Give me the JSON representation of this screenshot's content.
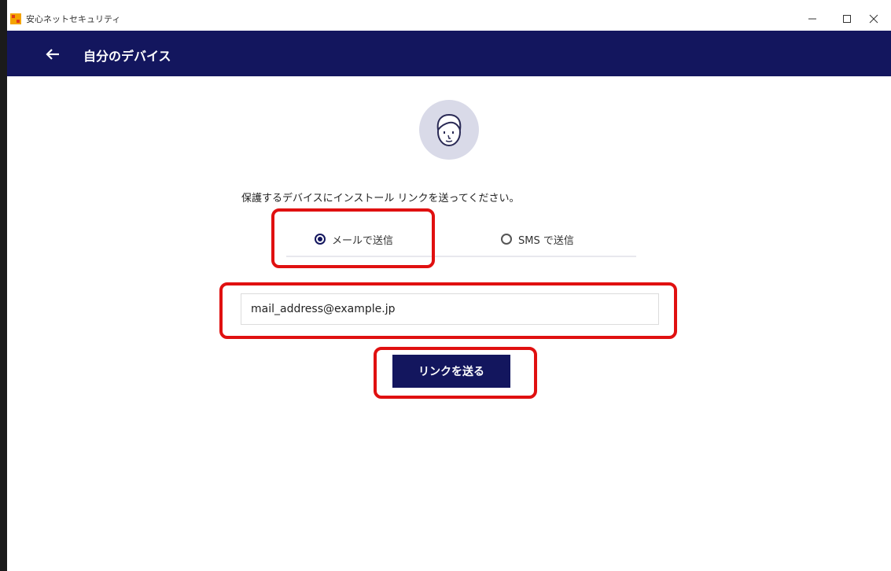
{
  "window": {
    "app_title": "安心ネットセキュリティ",
    "minimize_glyph": "–",
    "maximize_glyph": "☐",
    "close_glyph": "✕"
  },
  "header": {
    "back_icon": "arrow-left-icon",
    "title": "自分のデバイス"
  },
  "main": {
    "avatar_icon": "person-face-icon",
    "instruction": "保護するデバイスにインストール リンクを送ってください。",
    "options": [
      {
        "label": "メールで送信",
        "selected": true
      },
      {
        "label": "SMS で送信",
        "selected": false
      }
    ],
    "email_value": "mail_address@example.jp",
    "send_button_label": "リンクを送る"
  },
  "colors": {
    "header_bg": "#13165e",
    "button_bg": "#13165e",
    "highlight": "#e01010",
    "avatar_bg": "#d9dae8"
  }
}
